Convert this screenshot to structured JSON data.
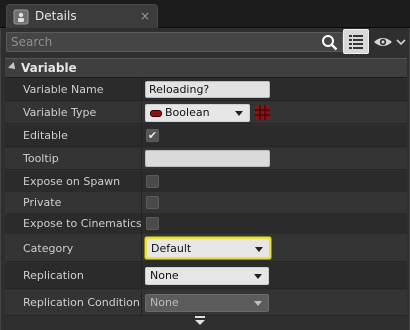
{
  "tab": {
    "label": "Details",
    "icon": "details-info-icon",
    "close_glyph": "×"
  },
  "search": {
    "placeholder": "Search",
    "value": "",
    "icon": "search-icon"
  },
  "toolbar": {
    "view_icon": "list-view-icon",
    "visibility_icon": "eye-icon"
  },
  "section": {
    "title": "Variable",
    "expanded": true
  },
  "rows": [
    {
      "label": "Variable Name",
      "type": "text",
      "value": "Reloading?"
    },
    {
      "label": "Variable Type",
      "type": "combo",
      "value": "Boolean",
      "pin_color": "#8a1414"
    },
    {
      "label": "Editable",
      "type": "checkbox",
      "checked": true,
      "check_glyph": "✔"
    },
    {
      "label": "Tooltip",
      "type": "text",
      "value": ""
    },
    {
      "label": "Expose on Spawn",
      "type": "checkbox",
      "checked": false
    },
    {
      "label": "Private",
      "type": "checkbox",
      "checked": false
    },
    {
      "label": "Expose to Cinematics",
      "type": "checkbox",
      "checked": false
    },
    {
      "label": "Category",
      "type": "combo",
      "value": "Default",
      "focused": true
    },
    {
      "label": "Replication",
      "type": "combo",
      "value": "None"
    },
    {
      "label": "Replication Condition",
      "type": "combo",
      "value": "None",
      "disabled": true
    }
  ],
  "colors": {
    "panel_bg": "#2f2f2f",
    "focus_outline": "#e8e23a",
    "boolean_pin": "#8a1414"
  }
}
